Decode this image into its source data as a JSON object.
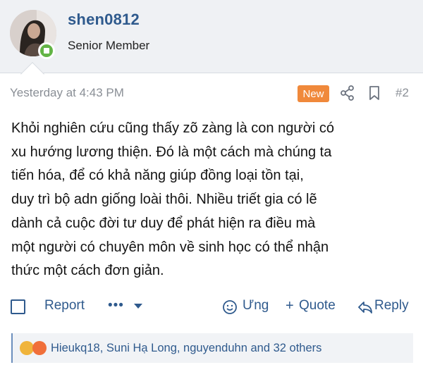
{
  "user": {
    "name": "shen0812",
    "title": "Senior Member"
  },
  "post": {
    "time": "Yesterday at 4:43 PM",
    "new_badge": "New",
    "number": "#2",
    "lines": [
      "Khỏi nghiên cứu cũng thấy zõ zàng là con người có",
      "xu hướng lương thiện. Đó là một cách mà chúng ta",
      "tiến hóa, để có khả năng giúp đồng loại tồn tại,",
      "duy trì bộ adn giống loài thôi. Nhiều triết gia có lẽ",
      "dành cả cuộc đời tư duy để phát hiện ra điều mà",
      "một người có chuyên môn về sinh học có thể nhận",
      "thức một cách đơn giản."
    ]
  },
  "actions": {
    "report": "Report",
    "more": "•••",
    "react": "Ưng",
    "quote": "Quote",
    "reply": "Reply"
  },
  "reactions": {
    "summary": "Hieukq18, Suni Hạ Long, nguyenduhn and 32 others"
  },
  "colors": {
    "accent": "#2f5a8d",
    "badge": "#f0893b",
    "online": "#63b446"
  },
  "icons": [
    "share-icon",
    "bookmark-icon",
    "react-icon",
    "quote-plus-icon",
    "reply-icon",
    "online-status-icon"
  ]
}
